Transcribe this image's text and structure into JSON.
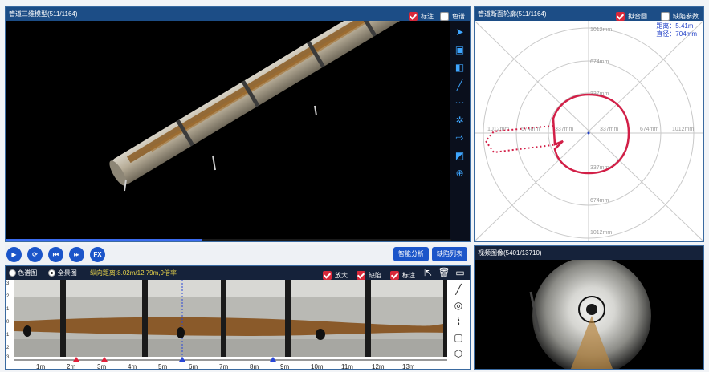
{
  "model3d": {
    "title": "管道三维模型(511/1164)",
    "label_annotate": "标注",
    "label_colormap": "色谱",
    "annotate_checked": true,
    "colormap_checked": false,
    "progress_fraction": 0.44,
    "tools": [
      "send-icon",
      "cube-icon",
      "cube-face-icon",
      "line-icon",
      "measure-icon",
      "gear-icon",
      "export-icon",
      "screenshot-icon",
      "zoom-icon"
    ]
  },
  "section": {
    "title": "管道断面轮廓(511/1164)",
    "label_fit": "拟合圆",
    "label_defect_params": "缺陷参数",
    "fit_checked": true,
    "defect_checked": false,
    "distance_label": "距离：5.41m",
    "diameter_label": "直径：704mm",
    "ring_labels": [
      "1012mm",
      "674mm",
      "337mm",
      "337mm",
      "674mm",
      "1012mm",
      "337mm",
      "674mm",
      "1012mm",
      "1012mm",
      "674mm",
      "337mm"
    ]
  },
  "controls": {
    "play": "▶",
    "b2": "⟳",
    "b3": "⏮",
    "b4": "⏭",
    "fx": "FX",
    "smart_analysis": "智能分析",
    "defect_list": "缺陷列表"
  },
  "unroll": {
    "opt_colormap": "色谱图",
    "opt_full": "全景图",
    "range_text": "纵向距离:8.02m/12.79m,9倍率",
    "label_zoom": "放大",
    "label_defect": "缺陷",
    "label_annotate": "标注",
    "axis_ticks": [
      "1m",
      "2m",
      "3m",
      "4m",
      "5m",
      "6m",
      "7m",
      "8m",
      "9m",
      "10m",
      "11m",
      "12m",
      "13m"
    ],
    "left_ticks": [
      "3",
      "2",
      "1",
      "0",
      "1",
      "2",
      "3"
    ]
  },
  "video": {
    "title": "视频图像(5401/13710)"
  }
}
